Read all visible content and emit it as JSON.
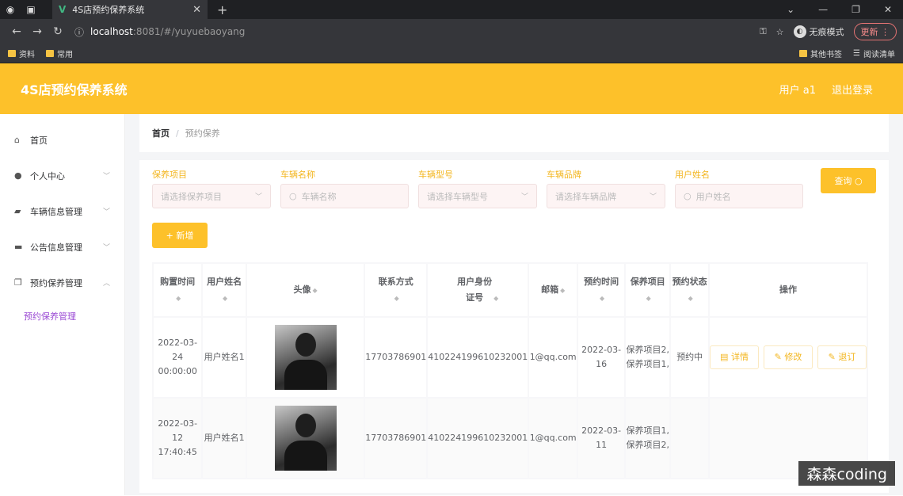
{
  "browser": {
    "tab_title": "4S店预约保养系统",
    "url_host": "localhost",
    "url_path": ":8081/#/yuyuebaoyang",
    "incognito_label": "无痕模式",
    "update_label": "更新",
    "bookmarks": [
      "资料",
      "常用"
    ],
    "bookmarks_right": [
      "其他书签",
      "阅读清单"
    ]
  },
  "header": {
    "title": "4S店预约保养系统",
    "user": "用户 a1",
    "logout": "退出登录"
  },
  "sidebar": {
    "items": [
      {
        "label": "首页"
      },
      {
        "label": "个人中心"
      },
      {
        "label": "车辆信息管理"
      },
      {
        "label": "公告信息管理"
      },
      {
        "label": "预约保养管理"
      }
    ],
    "sub_item": "预约保养管理"
  },
  "breadcrumb": {
    "home": "首页",
    "sep": "/",
    "current": "预约保养"
  },
  "search": {
    "fields": [
      {
        "label": "保养项目",
        "placeholder": "请选择保养项目"
      },
      {
        "label": "车辆名称",
        "placeholder": "车辆名称"
      },
      {
        "label": "车辆型号",
        "placeholder": "请选择车辆型号"
      },
      {
        "label": "车辆品牌",
        "placeholder": "请选择车辆品牌"
      },
      {
        "label": "用户姓名",
        "placeholder": "用户姓名"
      }
    ],
    "query_label": "查询",
    "add_label": "+ 新增"
  },
  "table": {
    "headers": [
      "购置时间",
      "用户姓名",
      "头像",
      "联系方式",
      "用户身份证号",
      "邮箱",
      "预约时间",
      "保养项目",
      "预约状态",
      "操作"
    ],
    "rows": [
      {
        "purchase_time": "2022-03-24 00:00:00",
        "user_name": "用户姓名1",
        "phone": "17703786901",
        "id_card": "410224199610232001",
        "email": "1@qq.com",
        "appoint_time": "2022-03-16",
        "project": "保养项目2,保养项目1,",
        "status": "预约中"
      },
      {
        "purchase_time": "2022-03-12 17:40:45",
        "user_name": "用户姓名1",
        "phone": "17703786901",
        "id_card": "410224199610232001",
        "email": "1@qq.com",
        "appoint_time": "2022-03-11",
        "project": "保养项目1,保养项目2,",
        "status": ""
      }
    ],
    "ops": [
      "详情",
      "修改",
      "退订"
    ]
  },
  "watermark": "森森coding"
}
